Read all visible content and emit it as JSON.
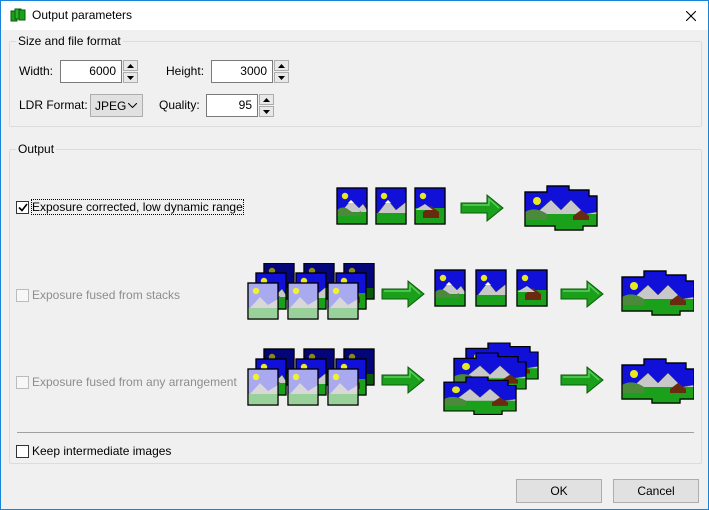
{
  "window": {
    "title": "Output parameters"
  },
  "size_group": {
    "title": "Size and file format",
    "width_label": "Width:",
    "width_value": "6000",
    "height_label": "Height:",
    "height_value": "3000",
    "ldr_format_label": "LDR Format:",
    "ldr_format_value": "JPEG",
    "quality_label": "Quality:",
    "quality_value": "95"
  },
  "output_group": {
    "title": "Output",
    "options": [
      {
        "label": "Exposure corrected, low dynamic range",
        "checked": true,
        "enabled": true
      },
      {
        "label": "Exposure fused from stacks",
        "checked": false,
        "enabled": false
      },
      {
        "label": "Exposure fused from any arrangement",
        "checked": false,
        "enabled": false
      }
    ],
    "keep_intermediate_label": "Keep intermediate images"
  },
  "buttons": {
    "ok": "OK",
    "cancel": "Cancel"
  },
  "colors": {
    "title_border": "#1883d7",
    "sky": "#1010d8",
    "grass": "#1aa01a",
    "arrow": "#1a9a1a"
  }
}
